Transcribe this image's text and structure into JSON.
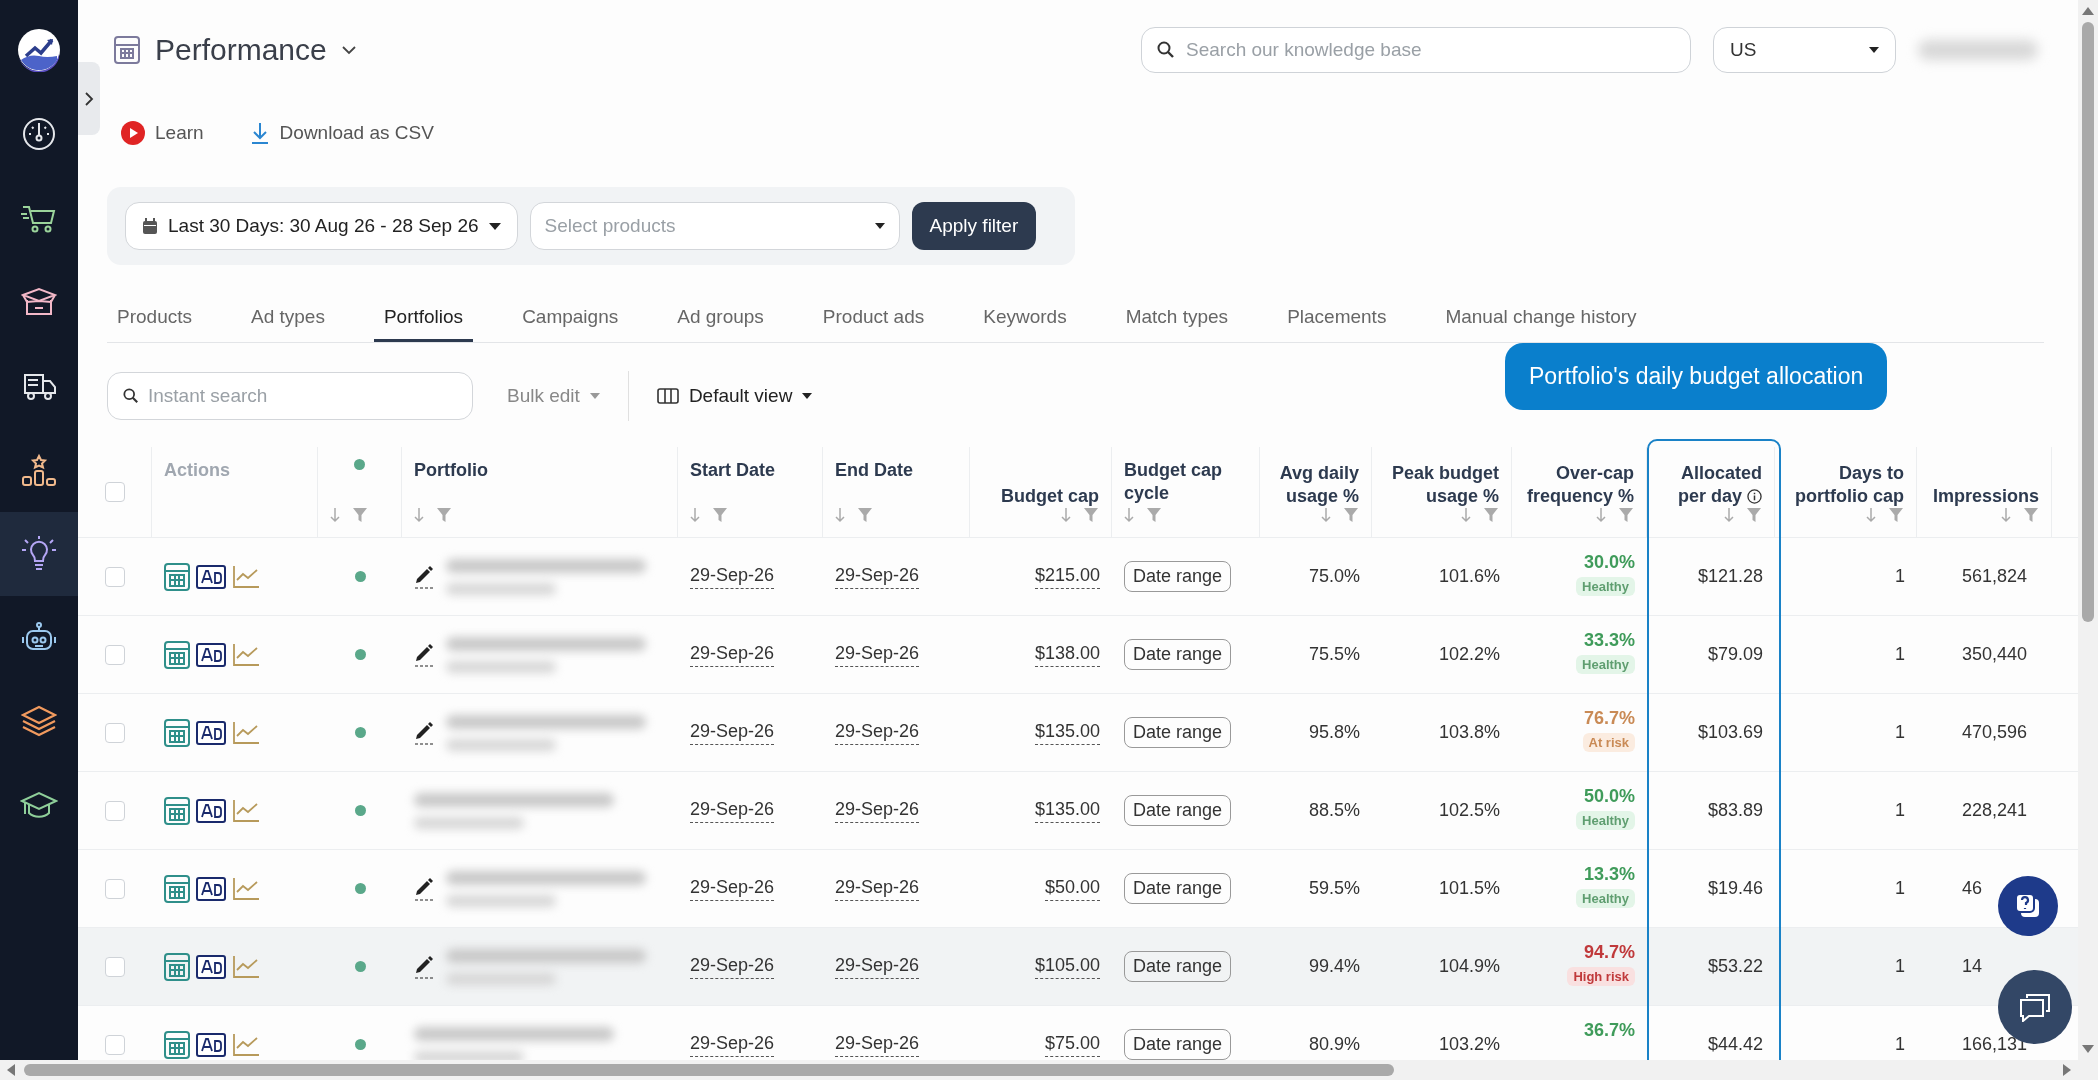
{
  "sidebar": {
    "items": [
      {
        "kind": "logo",
        "selected": false
      },
      {
        "kind": "gauge",
        "selected": false
      },
      {
        "kind": "cart",
        "selected": false
      },
      {
        "kind": "box",
        "selected": false
      },
      {
        "kind": "truck",
        "selected": false
      },
      {
        "kind": "blocks",
        "selected": false
      },
      {
        "kind": "bulb",
        "selected": true
      },
      {
        "kind": "robot",
        "selected": false
      },
      {
        "kind": "layers",
        "selected": false
      },
      {
        "kind": "cap",
        "selected": false
      }
    ]
  },
  "header": {
    "title": "Performance",
    "search_placeholder": "Search our knowledge base",
    "country": "US"
  },
  "links": [
    "Learn",
    "Download as CSV"
  ],
  "filters": {
    "date_range": "Last 30 Days: 30 Aug 26 - 28 Sep 26",
    "products_placeholder": "Select products",
    "apply": "Apply filter"
  },
  "tabs": [
    {
      "label": "Products",
      "selected": false
    },
    {
      "label": "Ad types",
      "selected": false
    },
    {
      "label": "Portfolios",
      "selected": true
    },
    {
      "label": "Campaigns",
      "selected": false
    },
    {
      "label": "Ad groups",
      "selected": false
    },
    {
      "label": "Product ads",
      "selected": false
    },
    {
      "label": "Keywords",
      "selected": false
    },
    {
      "label": "Match types",
      "selected": false
    },
    {
      "label": "Placements",
      "selected": false
    },
    {
      "label": "Manual change history",
      "selected": false
    }
  ],
  "toolbar": {
    "search_placeholder": "Instant search",
    "bulk_edit": "Bulk edit",
    "view": "Default view"
  },
  "tooltip": "Portfolio's daily budget allocation",
  "table": {
    "select_all_checked": false,
    "columns": [
      {
        "kind": "actions",
        "label": "Actions"
      },
      {
        "kind": "status"
      },
      {
        "kind": "text",
        "label": "Portfolio"
      },
      {
        "kind": "text",
        "label": "Start Date"
      },
      {
        "kind": "text",
        "label": "End Date"
      },
      {
        "kind": "number",
        "label": "Budget cap"
      },
      {
        "kind": "text",
        "label": "Budget cap cycle"
      },
      {
        "kind": "number",
        "label": "Avg daily usage %"
      },
      {
        "kind": "number",
        "label": "Peak budget usage %"
      },
      {
        "kind": "number",
        "label": "Over-cap frequency %"
      },
      {
        "kind": "number",
        "label": "Allocated per day",
        "info": true,
        "highlighted": true
      },
      {
        "kind": "number",
        "label": "Days to portfolio cap"
      },
      {
        "kind": "number",
        "label": "Impressions"
      }
    ],
    "rows": [
      {
        "checked": false,
        "hovered": false,
        "editable": true,
        "start": "29-Sep-26",
        "end": "29-Sep-26",
        "budget_cap": "$215.00",
        "cycle": "Date range",
        "avg": "75.0%",
        "peak": "101.6%",
        "overcap": {
          "value": "30.0%",
          "status": "Healthy",
          "kind": "healthy"
        },
        "allocated": "$121.28",
        "days": "1",
        "impressions": "561,824"
      },
      {
        "checked": false,
        "hovered": false,
        "editable": true,
        "start": "29-Sep-26",
        "end": "29-Sep-26",
        "budget_cap": "$138.00",
        "cycle": "Date range",
        "avg": "75.5%",
        "peak": "102.2%",
        "overcap": {
          "value": "33.3%",
          "status": "Healthy",
          "kind": "healthy"
        },
        "allocated": "$79.09",
        "days": "1",
        "impressions": "350,440"
      },
      {
        "checked": false,
        "hovered": false,
        "editable": true,
        "start": "29-Sep-26",
        "end": "29-Sep-26",
        "budget_cap": "$135.00",
        "cycle": "Date range",
        "avg": "95.8%",
        "peak": "103.8%",
        "overcap": {
          "value": "76.7%",
          "status": "At risk",
          "kind": "at_risk"
        },
        "allocated": "$103.69",
        "days": "1",
        "impressions": "470,596"
      },
      {
        "checked": false,
        "hovered": false,
        "editable": false,
        "start": "29-Sep-26",
        "end": "29-Sep-26",
        "budget_cap": "$135.00",
        "cycle": "Date range",
        "avg": "88.5%",
        "peak": "102.5%",
        "overcap": {
          "value": "50.0%",
          "status": "Healthy",
          "kind": "healthy"
        },
        "allocated": "$83.89",
        "days": "1",
        "impressions": "228,241"
      },
      {
        "checked": false,
        "hovered": false,
        "editable": true,
        "start": "29-Sep-26",
        "end": "29-Sep-26",
        "budget_cap": "$50.00",
        "cycle": "Date range",
        "avg": "59.5%",
        "peak": "101.5%",
        "overcap": {
          "value": "13.3%",
          "status": "Healthy",
          "kind": "healthy"
        },
        "allocated": "$19.46",
        "days": "1",
        "impressions": "46"
      },
      {
        "checked": false,
        "hovered": true,
        "editable": true,
        "start": "29-Sep-26",
        "end": "29-Sep-26",
        "budget_cap": "$105.00",
        "cycle": "Date range",
        "avg": "99.4%",
        "peak": "104.9%",
        "overcap": {
          "value": "94.7%",
          "status": "High risk",
          "kind": "high_risk"
        },
        "allocated": "$53.22",
        "days": "1",
        "impressions": "14"
      },
      {
        "checked": false,
        "hovered": false,
        "editable": false,
        "start": "29-Sep-26",
        "end": "29-Sep-26",
        "budget_cap": "$75.00",
        "cycle": "Date range",
        "avg": "80.9%",
        "peak": "103.2%",
        "overcap": {
          "value": "36.7%",
          "kind": "healthy"
        },
        "allocated": "$44.42",
        "days": "1",
        "impressions": "166,131"
      }
    ]
  }
}
